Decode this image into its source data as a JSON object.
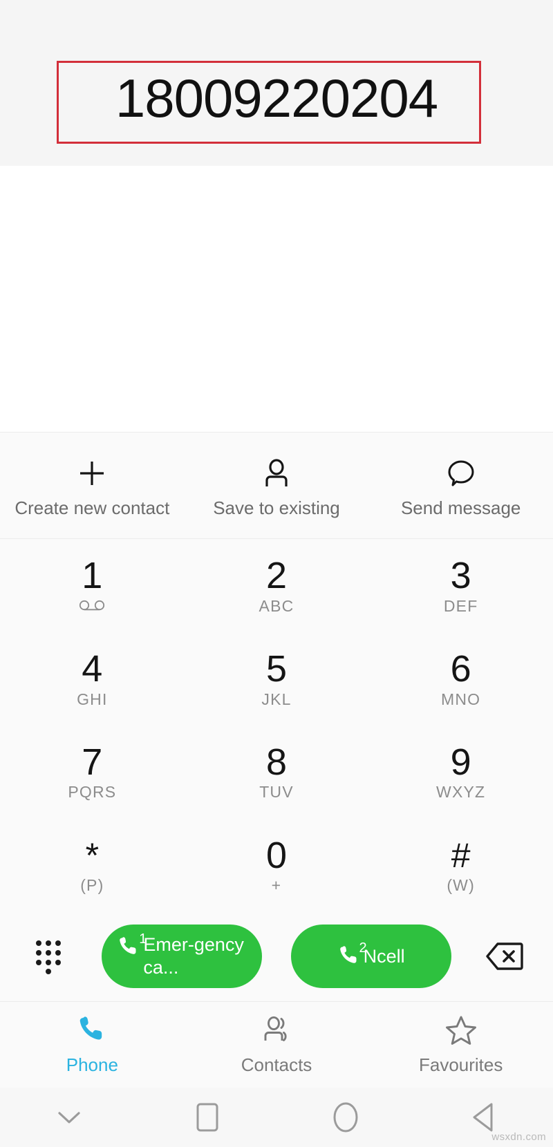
{
  "display": {
    "phone_number": "18009220204",
    "annotation": "red-highlight-box",
    "annotation_color": "#d32f3a"
  },
  "actions": [
    {
      "label": "Create new contact",
      "icon": "plus-icon"
    },
    {
      "label": "Save to existing",
      "icon": "person-icon"
    },
    {
      "label": "Send message",
      "icon": "message-bubble-icon"
    }
  ],
  "keypad": [
    {
      "digit": "1",
      "sub": "",
      "icon": "voicemail-icon"
    },
    {
      "digit": "2",
      "sub": "ABC",
      "icon": ""
    },
    {
      "digit": "3",
      "sub": "DEF",
      "icon": ""
    },
    {
      "digit": "4",
      "sub": "GHI",
      "icon": ""
    },
    {
      "digit": "5",
      "sub": "JKL",
      "icon": ""
    },
    {
      "digit": "6",
      "sub": "MNO",
      "icon": ""
    },
    {
      "digit": "7",
      "sub": "PQRS",
      "icon": ""
    },
    {
      "digit": "8",
      "sub": "TUV",
      "icon": ""
    },
    {
      "digit": "9",
      "sub": "WXYZ",
      "icon": ""
    },
    {
      "digit": "*",
      "sub": "(P)",
      "icon": ""
    },
    {
      "digit": "0",
      "sub": "+",
      "icon": ""
    },
    {
      "digit": "#",
      "sub": "(W)",
      "icon": ""
    }
  ],
  "call_row": {
    "pad_toggle_icon": "dialpad-dots-icon",
    "backspace_icon": "backspace-delete-icon",
    "buttons": [
      {
        "label": "Emer-gency ca...",
        "sim": "1",
        "icon": "phone-handset-icon",
        "color": "#2ec13f"
      },
      {
        "label": "Ncell",
        "sim": "2",
        "icon": "phone-handset-icon",
        "color": "#2ec13f"
      }
    ]
  },
  "tabs": [
    {
      "label": "Phone",
      "icon": "phone-handset-icon",
      "active": true,
      "color": "#2bb3e0"
    },
    {
      "label": "Contacts",
      "icon": "contacts-people-icon",
      "active": false,
      "color": "#7a7a7a"
    },
    {
      "label": "Favourites",
      "icon": "star-icon",
      "active": false,
      "color": "#7a7a7a"
    }
  ],
  "navbar": [
    {
      "icon": "chevron-down-icon"
    },
    {
      "icon": "square-recents-icon"
    },
    {
      "icon": "circle-home-icon"
    },
    {
      "icon": "triangle-back-icon"
    }
  ],
  "watermark": "wsxdn.com"
}
